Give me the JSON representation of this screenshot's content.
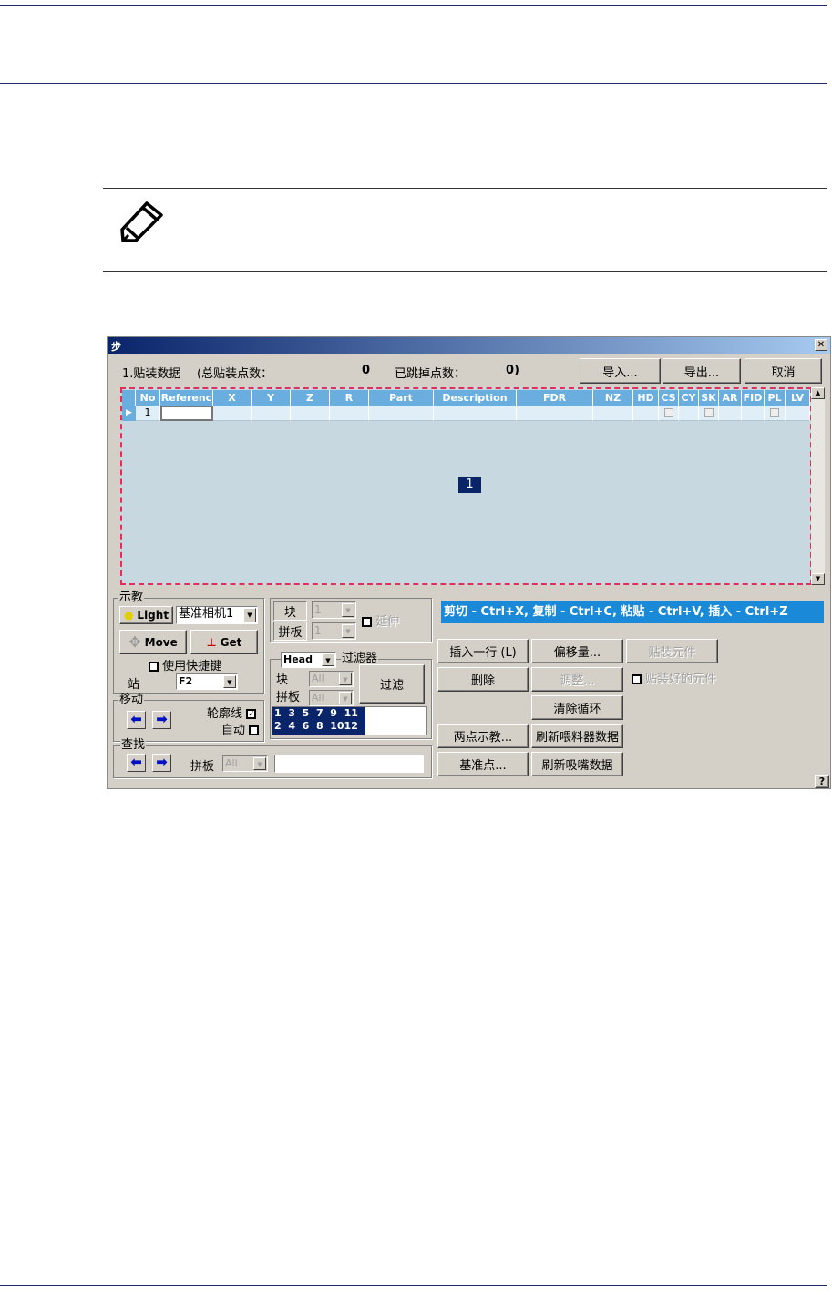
{
  "dialog": {
    "title": "步",
    "summary": {
      "label": "1.贴装数据",
      "total_label": "(总贴装点数：",
      "total_value": "0",
      "skipped_label": "已跳掉点数：",
      "skipped_value": "0)"
    },
    "buttons": {
      "import": "导入...",
      "export": "导出...",
      "cancel": "取消"
    },
    "grid": {
      "columns": [
        "No",
        "Referenc",
        "X",
        "Y",
        "Z",
        "R",
        "Part",
        "Description",
        "FDR",
        "NZ",
        "HD",
        "CS",
        "CY",
        "SK",
        "AR",
        "FID",
        "PL",
        "LV"
      ],
      "rows": [
        {
          "No": "1"
        }
      ],
      "page_marker": "1"
    },
    "teach": {
      "group": "示教",
      "light": "Light",
      "camera": "基准相机1",
      "move": "Move",
      "get": "Get",
      "shortcut": "使用快捷键",
      "station_label": "站",
      "station": "F2"
    },
    "move_group": {
      "group": "移动",
      "contour": "轮廓线",
      "contour_checked": true,
      "auto": "自动",
      "auto_checked": false
    },
    "find_group": {
      "group": "查找",
      "panel_label": "拼板",
      "panel_value": "All",
      "search_value": ""
    },
    "block": {
      "block_label": "块",
      "block_value": "1",
      "panel_label": "拼板",
      "panel_value": "1",
      "extend": "延伸"
    },
    "filter": {
      "head": "Head",
      "group": "过滤器",
      "block_label": "块",
      "block_value": "All",
      "panel_label": "拼板",
      "panel_value": "All",
      "filter_button": "过滤",
      "list_row1": "1  3  5  7  9  11",
      "list_row2": "2  4  6  8  1012"
    },
    "hint": "剪切 - Ctrl+X, 复制 - Ctrl+C, 粘贴 - Ctrl+V, 插入 - Ctrl+Z",
    "actions": {
      "insert_row": "插入一行 (L)",
      "offset": "偏移量...",
      "place": "贴装元件",
      "delete": "删除",
      "adjust": "调整...",
      "placed": "贴装好的元件",
      "clear_loop": "清除循环",
      "two_point": "两点示教...",
      "refresh_feeder": "刷新喂料器数据",
      "fiducial": "基准点...",
      "refresh_nozzle": "刷新吸嘴数据",
      "help": "?"
    },
    "colors": {
      "title_start": "#0a246a",
      "hint_bg": "#1a8ad8",
      "grid_header": "#6aaee0",
      "selection": "#0a246a"
    }
  }
}
